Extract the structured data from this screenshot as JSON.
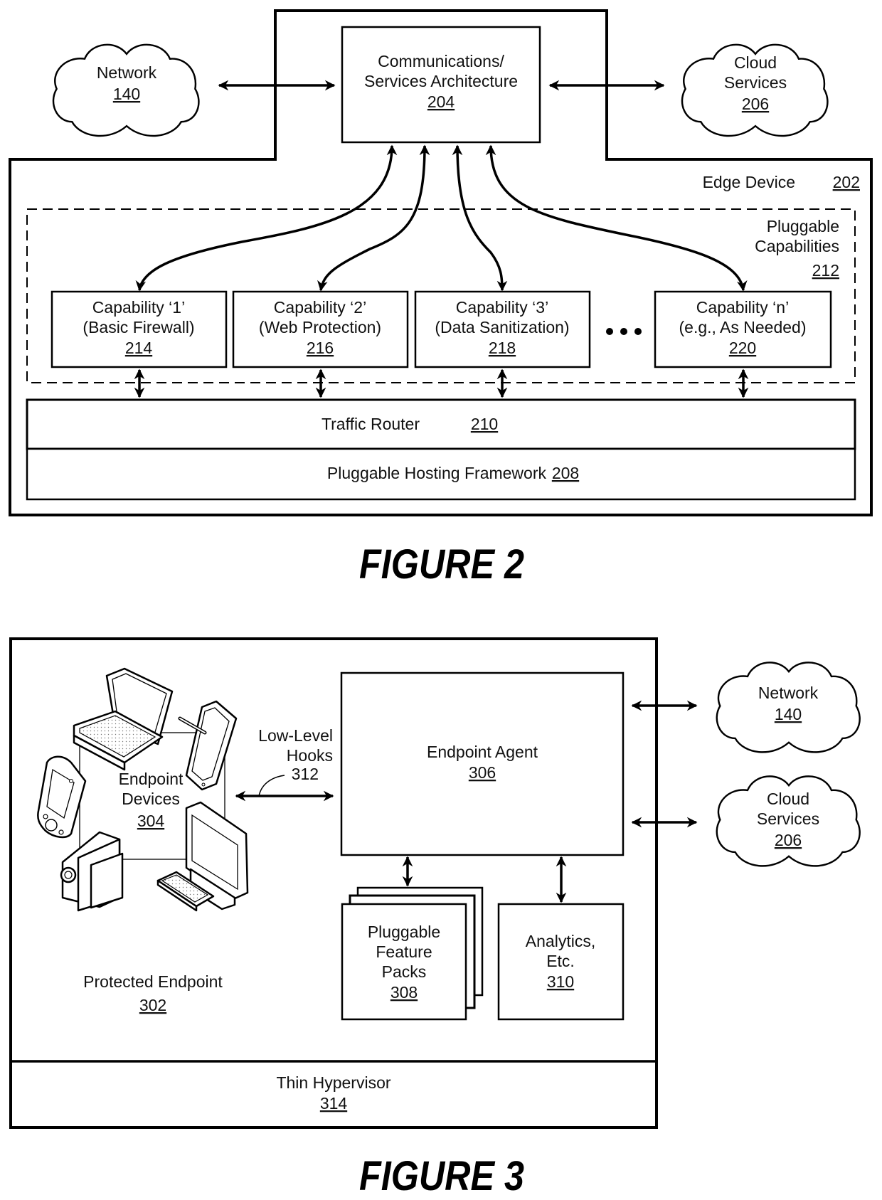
{
  "figure2": {
    "caption": "FIGURE 2",
    "edge_device": {
      "label": "Edge Device",
      "ref": "202"
    },
    "comm_arch": {
      "line1": "Communications/",
      "line2": "Services Architecture",
      "ref": "204"
    },
    "network": {
      "label": "Network",
      "ref": "140"
    },
    "cloud_services": {
      "line1": "Cloud",
      "line2": "Services",
      "ref": "206"
    },
    "pluggable_capabilities": {
      "line1": "Pluggable",
      "line2": "Capabilities",
      "ref": "212"
    },
    "capabilities": [
      {
        "title": "Capability ‘1’",
        "subtitle": "(Basic Firewall)",
        "ref": "214"
      },
      {
        "title": "Capability ‘2’",
        "subtitle": "(Web Protection)",
        "ref": "216"
      },
      {
        "title": "Capability ‘3’",
        "subtitle": "(Data Sanitization)",
        "ref": "218"
      },
      {
        "title": "Capability ‘n’",
        "subtitle": "(e.g., As Needed)",
        "ref": "220"
      }
    ],
    "ellipsis": "• • •",
    "traffic_router": {
      "label": "Traffic Router",
      "ref": "210"
    },
    "hosting_framework": {
      "label": "Pluggable Hosting Framework",
      "ref": "208"
    }
  },
  "figure3": {
    "caption": "FIGURE 3",
    "endpoint_devices": {
      "line1": "Endpoint",
      "line2": "Devices",
      "ref": "304"
    },
    "low_level_hooks": {
      "line1": "Low-Level",
      "line2": "Hooks",
      "ref": "312"
    },
    "endpoint_agent": {
      "label": "Endpoint Agent",
      "ref": "306"
    },
    "feature_packs": {
      "line1": "Pluggable",
      "line2": "Feature",
      "line3": "Packs",
      "ref": "308"
    },
    "analytics": {
      "line1": "Analytics,",
      "line2": "Etc.",
      "ref": "310"
    },
    "protected_endpoint": {
      "label": "Protected Endpoint",
      "ref": "302"
    },
    "thin_hypervisor": {
      "label": "Thin Hypervisor",
      "ref": "314"
    },
    "network": {
      "label": "Network",
      "ref": "140"
    },
    "cloud_services": {
      "line1": "Cloud",
      "line2": "Services",
      "ref": "206"
    }
  },
  "icons": [
    "laptop-icon",
    "tablet-icon",
    "pda-icon",
    "camcorder-icon",
    "desktop-monitor-icon",
    "cloud-icon"
  ]
}
